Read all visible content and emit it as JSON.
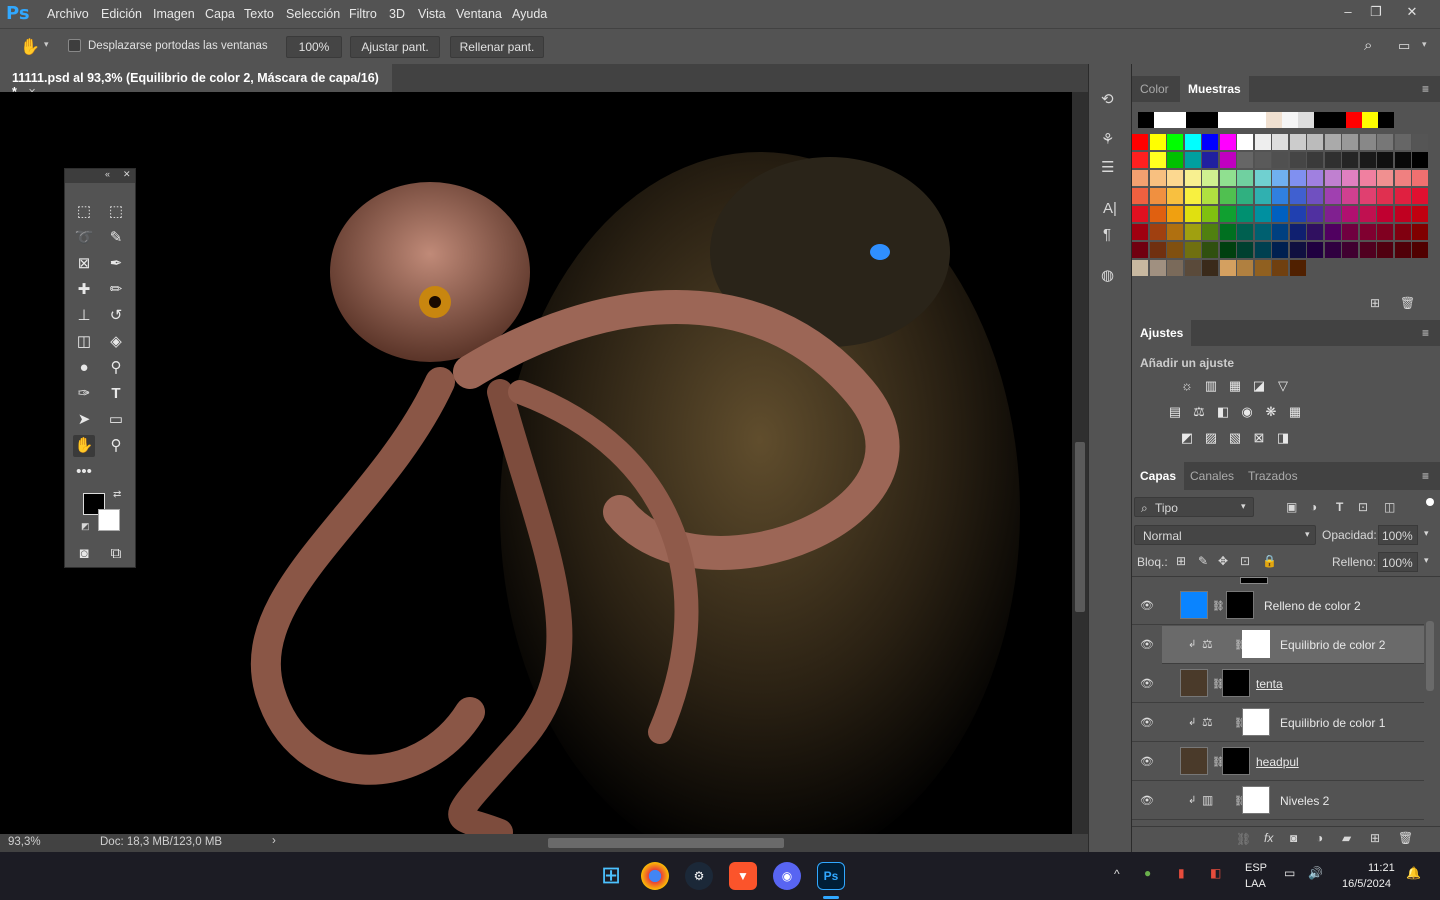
{
  "app": {
    "logo": "Ps"
  },
  "menu": [
    "Archivo",
    "Edición",
    "Imagen",
    "Capa",
    "Texto",
    "Selección",
    "Filtro",
    "3D",
    "Vista",
    "Ventana",
    "Ayuda"
  ],
  "options": {
    "scroll_all_label": "Desplazarse portodas las ventanas",
    "zoom_value": "100%",
    "fit_screen": "Ajustar pant.",
    "fill_screen": "Rellenar pant."
  },
  "document": {
    "tab_title": "11111.psd al 93,3% (Equilibrio de color 2, Máscara de capa/16) *",
    "close": "×"
  },
  "status": {
    "zoom": "93,3%",
    "doc_size": "Doc: 18,3 MB/123,0 MB",
    "arrow": "›"
  },
  "color_panel": {
    "tabs": [
      "Color",
      "Muestras"
    ],
    "active_tab": "Muestras"
  },
  "adjustments_panel": {
    "title": "Ajustes",
    "subtitle": "Añadir un ajuste"
  },
  "layers_panel": {
    "tabs": [
      "Capas",
      "Canales",
      "Trazados"
    ],
    "filter_label": "Tipo",
    "blend_mode": "Normal",
    "opacity_label": "Opacidad:",
    "opacity_value": "100%",
    "lock_label": "Bloq.:",
    "fill_label": "Relleno:",
    "fill_value": "100%",
    "layers": [
      {
        "name": "Relleno de color 2",
        "selected": false
      },
      {
        "name": "Equilibrio de color 2",
        "selected": true
      },
      {
        "name": "tenta",
        "selected": false
      },
      {
        "name": "Equilibrio de color 1",
        "selected": false
      },
      {
        "name": "headpul",
        "selected": false
      },
      {
        "name": "Niveles 2",
        "selected": false
      }
    ]
  },
  "taskbar": {
    "lang": "ESP",
    "layout": "LAA",
    "time": "11:21",
    "date": "16/5/2024"
  },
  "colors": {
    "ui_bg": "#535353",
    "accent": "#31a8ff",
    "fill_layer": "#0a84ff"
  }
}
